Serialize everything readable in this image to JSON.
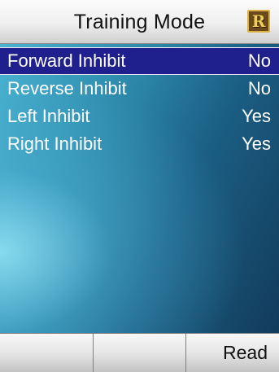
{
  "header": {
    "title": "Training Mode",
    "logo_letter": "R",
    "logo_icon": "r-logo-icon"
  },
  "list": {
    "selected_index": 0,
    "items": [
      {
        "label": "Forward Inhibit",
        "value": "No"
      },
      {
        "label": "Reverse Inhibit",
        "value": "No"
      },
      {
        "label": "Left Inhibit",
        "value": "Yes"
      },
      {
        "label": "Right Inhibit",
        "value": "Yes"
      }
    ]
  },
  "softkeys": {
    "left": "",
    "middle": "",
    "right": "Read"
  },
  "colors": {
    "selection": "#1f1f8d",
    "text": "#ffffff",
    "background_accent": "#2c87a4"
  }
}
